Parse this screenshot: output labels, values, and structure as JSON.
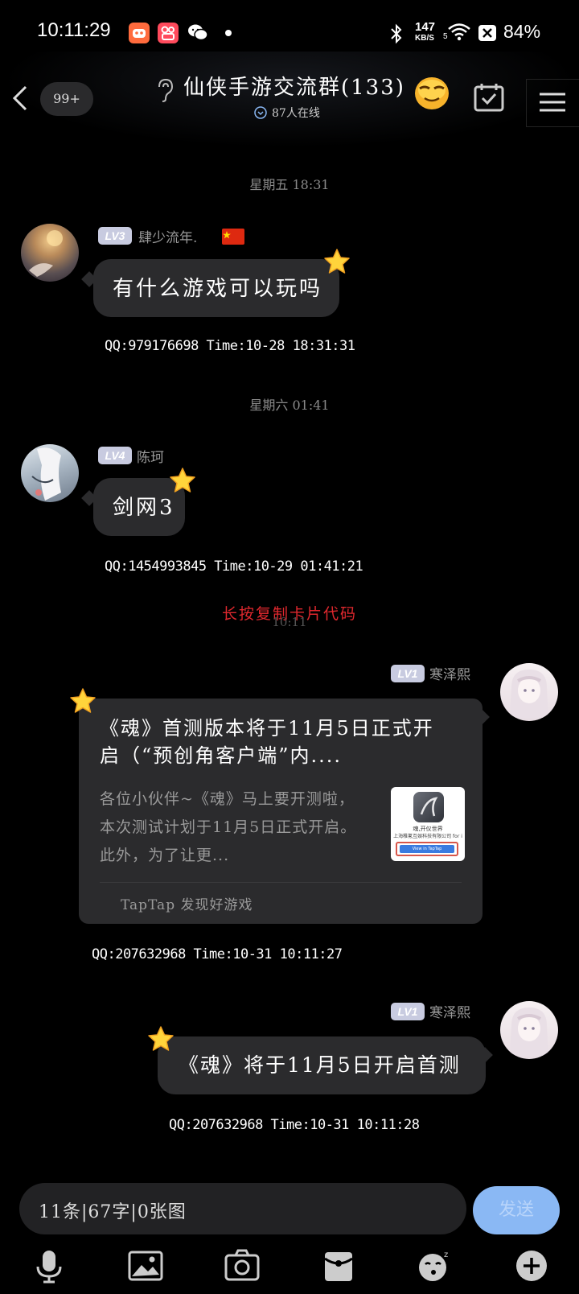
{
  "status_bar": {
    "time": "10:11:29",
    "net_speed_value": "147",
    "net_speed_unit": "KB/S",
    "wifi_gen": "5",
    "battery": "84%"
  },
  "header": {
    "unread_badge": "99+",
    "title": "仙侠手游交流群(133)",
    "online_text": "87人在线"
  },
  "messages": [
    {
      "timestamp": "星期五 18:31",
      "level": "LV3",
      "nickname": "肆少流年.",
      "text": "有什么游戏可以玩吗",
      "meta": "QQ:979176698 Time:10-28 18:31:31"
    },
    {
      "timestamp": "星期六 01:41",
      "level": "LV4",
      "nickname": "陈珂",
      "text": "剑网3",
      "meta": "QQ:1454993845 Time:10-29 01:41:21"
    },
    {
      "hint_red": "长按复制卡片代码",
      "timestamp": "10:11",
      "level": "LV1",
      "nickname": "寒泽熙",
      "card_title": "《魂》首测版本将于11月5日正式开启（“预创角客户端”内....",
      "card_desc": "各位小伙伴~《魂》马上要开测啦，本次测试计划于11月5日正式开启。此外，为了让更...",
      "card_thumb_caption": "魂,开仪世界",
      "card_thumb_company": "上海稚氪互娱科技有限公司 for i",
      "card_thumb_button": "View in TapTap",
      "card_source": "TapTap 发现好游戏",
      "meta": "QQ:207632968 Time:10-31 10:11:27"
    },
    {
      "level": "LV1",
      "nickname": "寒泽熙",
      "text": "《魂》将于11月5日开启首测",
      "meta": "QQ:207632968 Time:10-31 10:11:28"
    }
  ],
  "input": {
    "value": "11条|67字|0张图",
    "send_label": "发送"
  },
  "colors": {
    "background": "#000000",
    "bubble": "#2b2b2d",
    "accent_blue": "#8ab8f4",
    "hint_red": "#e0282e"
  }
}
